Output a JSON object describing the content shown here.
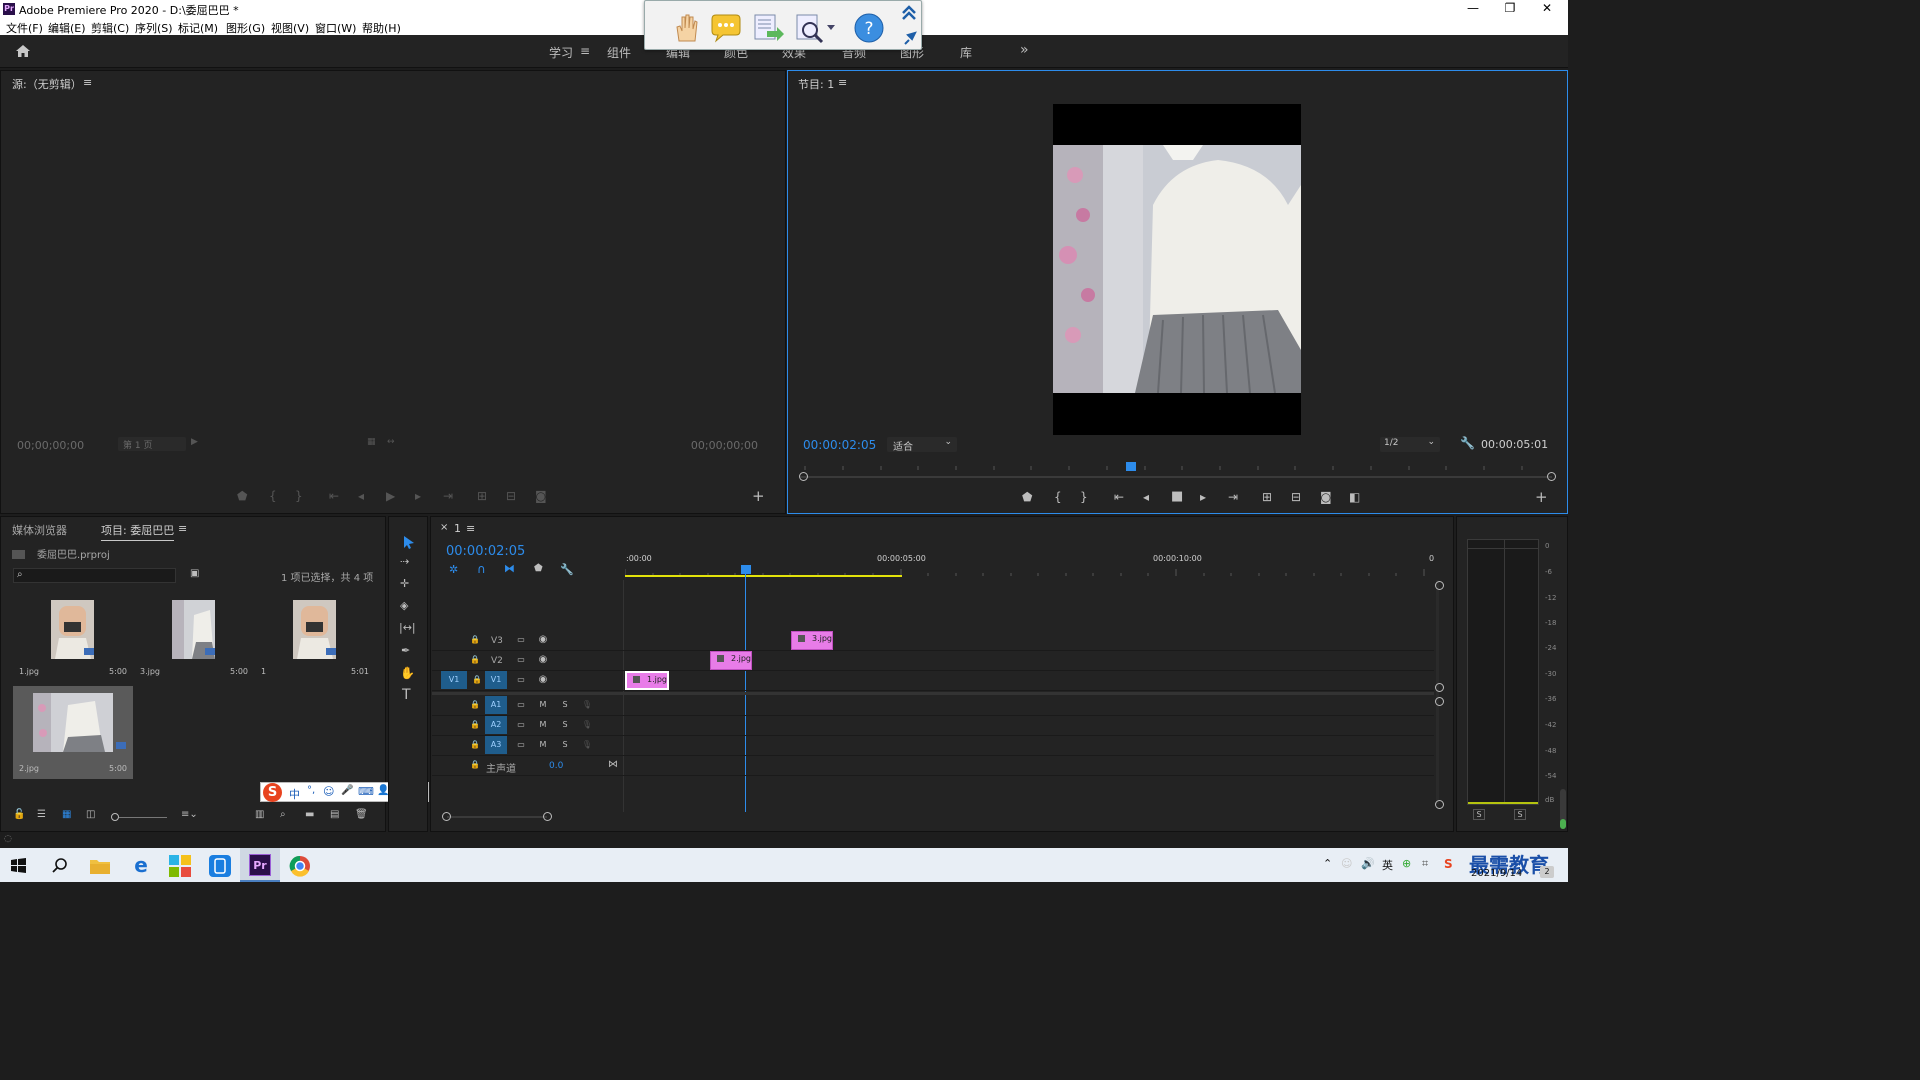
{
  "window": {
    "title": "Adobe Premiere Pro 2020 - D:\\委屈巴巴 *",
    "app_icon": "Pr",
    "minimize": "—",
    "maximize": "❐",
    "close": "✕"
  },
  "menu": [
    "文件(F)",
    "编辑(E)",
    "剪辑(C)",
    "序列(S)",
    "标记(M)",
    "图形(G)",
    "视图(V)",
    "窗口(W)",
    "帮助(H)"
  ],
  "workspaces": {
    "learn": "学习",
    "learn_menu": "≡",
    "assembly": "组件",
    "editing": "编辑",
    "color": "颜色",
    "effects": "效果",
    "audio": "音频",
    "graphics": "图形",
    "libraries": "库",
    "more": "»"
  },
  "source_panel": {
    "title": "源:（无剪辑）",
    "menu_icon": "≡",
    "timecode_in": "00;00;00;00",
    "page_select": "第 1 页",
    "timecode_out": "00;00;00;00",
    "add": "+"
  },
  "program_panel": {
    "title": "节目: 1",
    "menu_icon": "≡",
    "timecode": "00:00:02:05",
    "fit": "适合",
    "resolution": "1/2",
    "duration": "00:00:05:01",
    "add": "+",
    "playhead_fraction": 0.44
  },
  "project_panel": {
    "tabs": [
      "媒体浏览器",
      "项目: 委屈巴巴"
    ],
    "menu_icon": "≡",
    "project_file": "委屈巴巴.prproj",
    "search_placeholder": "",
    "selection_info": "1 项已选择，共 4 项",
    "items": [
      {
        "name": "1.jpg",
        "duration": "5:00"
      },
      {
        "name": "3.jpg",
        "duration": "5:00"
      },
      {
        "name": "1",
        "duration": "5:01"
      },
      {
        "name": "2.jpg",
        "duration": "5:00"
      }
    ]
  },
  "ime_bar": {
    "logo": "S",
    "items": [
      "中",
      "°,",
      "☺",
      "🎤",
      "⌨",
      "👤",
      "👕",
      "▦"
    ]
  },
  "timeline": {
    "tab_close": "×",
    "tab": "1",
    "menu_icon": "≡",
    "timecode": "00:00:02:05",
    "ruler": ":00:00",
    "ruler_5": "00:00:05:00",
    "ruler_10": "00:00:10:00",
    "ruler_end": "0",
    "video_tracks": [
      {
        "label": "V3",
        "clip": "3.jpg"
      },
      {
        "label": "V2",
        "clip": "2.jpg"
      },
      {
        "label": "V1",
        "clip": "1.jpg",
        "source_patch": "V1"
      }
    ],
    "audio_tracks": [
      {
        "label": "A1",
        "m": "M",
        "s": "S"
      },
      {
        "label": "A2",
        "m": "M",
        "s": "S"
      },
      {
        "label": "A3",
        "m": "M",
        "s": "S"
      }
    ],
    "master": {
      "label": "主声道",
      "value": "0.0"
    }
  },
  "meter": {
    "ticks": [
      "0",
      "-6",
      "-12",
      "-18",
      "-24",
      "-30",
      "-36",
      "-42",
      "-48",
      "-54",
      "dB"
    ],
    "solo_left": "S",
    "solo_right": "S"
  },
  "taskbar": {
    "time": "2021/9/14",
    "watermark": "最需教育",
    "badge": "2"
  },
  "colors": {
    "accent": "#2d8ceb",
    "clip": "#e87ce8",
    "panel": "#232323",
    "active_border": "#2d8ceb"
  }
}
